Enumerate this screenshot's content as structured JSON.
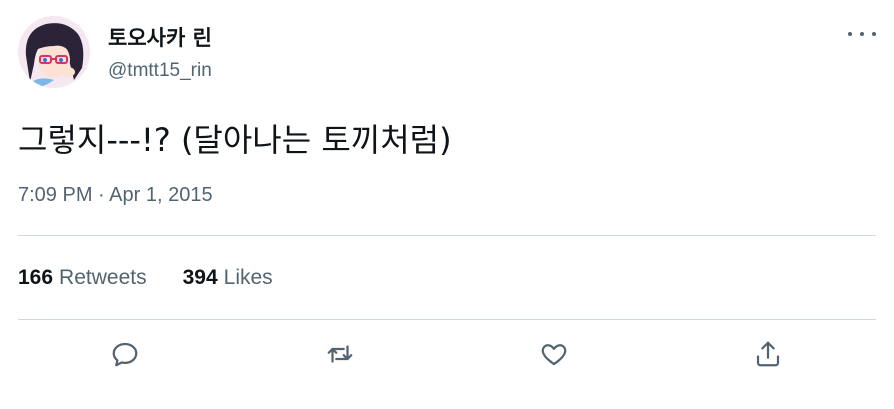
{
  "author": {
    "display_name": "토오사카 린",
    "handle": "@tmtt15_rin"
  },
  "tweet": {
    "text": "그렇지---!? (달아나는 토끼처럼)",
    "timestamp": "7:09 PM · Apr 1, 2015"
  },
  "stats": {
    "retweets_count": "166",
    "retweets_label": "Retweets",
    "likes_count": "394",
    "likes_label": "Likes"
  },
  "actions": [
    "reply-icon",
    "retweet-icon",
    "like-icon",
    "share-icon"
  ],
  "colors": {
    "primary_text": "#0f1419",
    "secondary_text": "#536471",
    "divider": "#cfd9de"
  }
}
